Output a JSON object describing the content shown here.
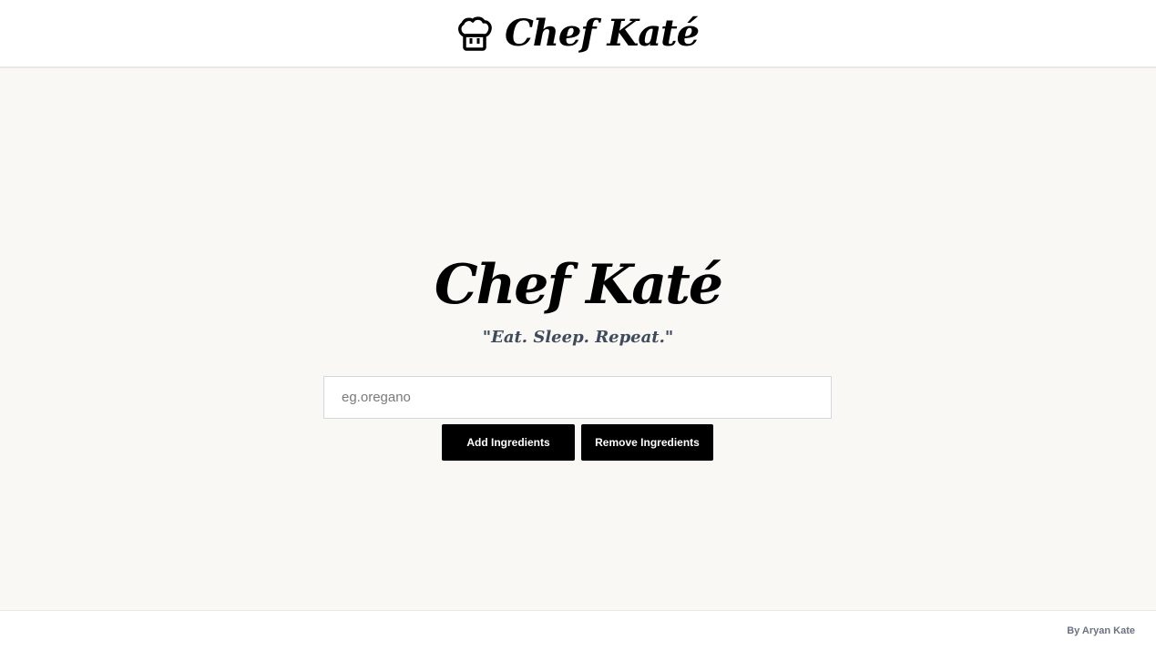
{
  "header": {
    "icon": "chef-hat-icon",
    "title": "Chef Katé"
  },
  "hero": {
    "title": "Chef Katé",
    "tagline": "\"Eat. Sleep. Repeat.\""
  },
  "search": {
    "placeholder": "eg.oregano",
    "value": ""
  },
  "actions": {
    "add_label": "Add Ingredients",
    "remove_label": "Remove Ingredients"
  },
  "footer": {
    "credit": "By Aryan Kate"
  },
  "colors": {
    "background": "#f9f8f5",
    "header_bg": "#ffffff",
    "button_bg": "#000000",
    "button_text": "#ffffff",
    "tagline": "#3f4a5c",
    "credit": "#6b7280"
  }
}
